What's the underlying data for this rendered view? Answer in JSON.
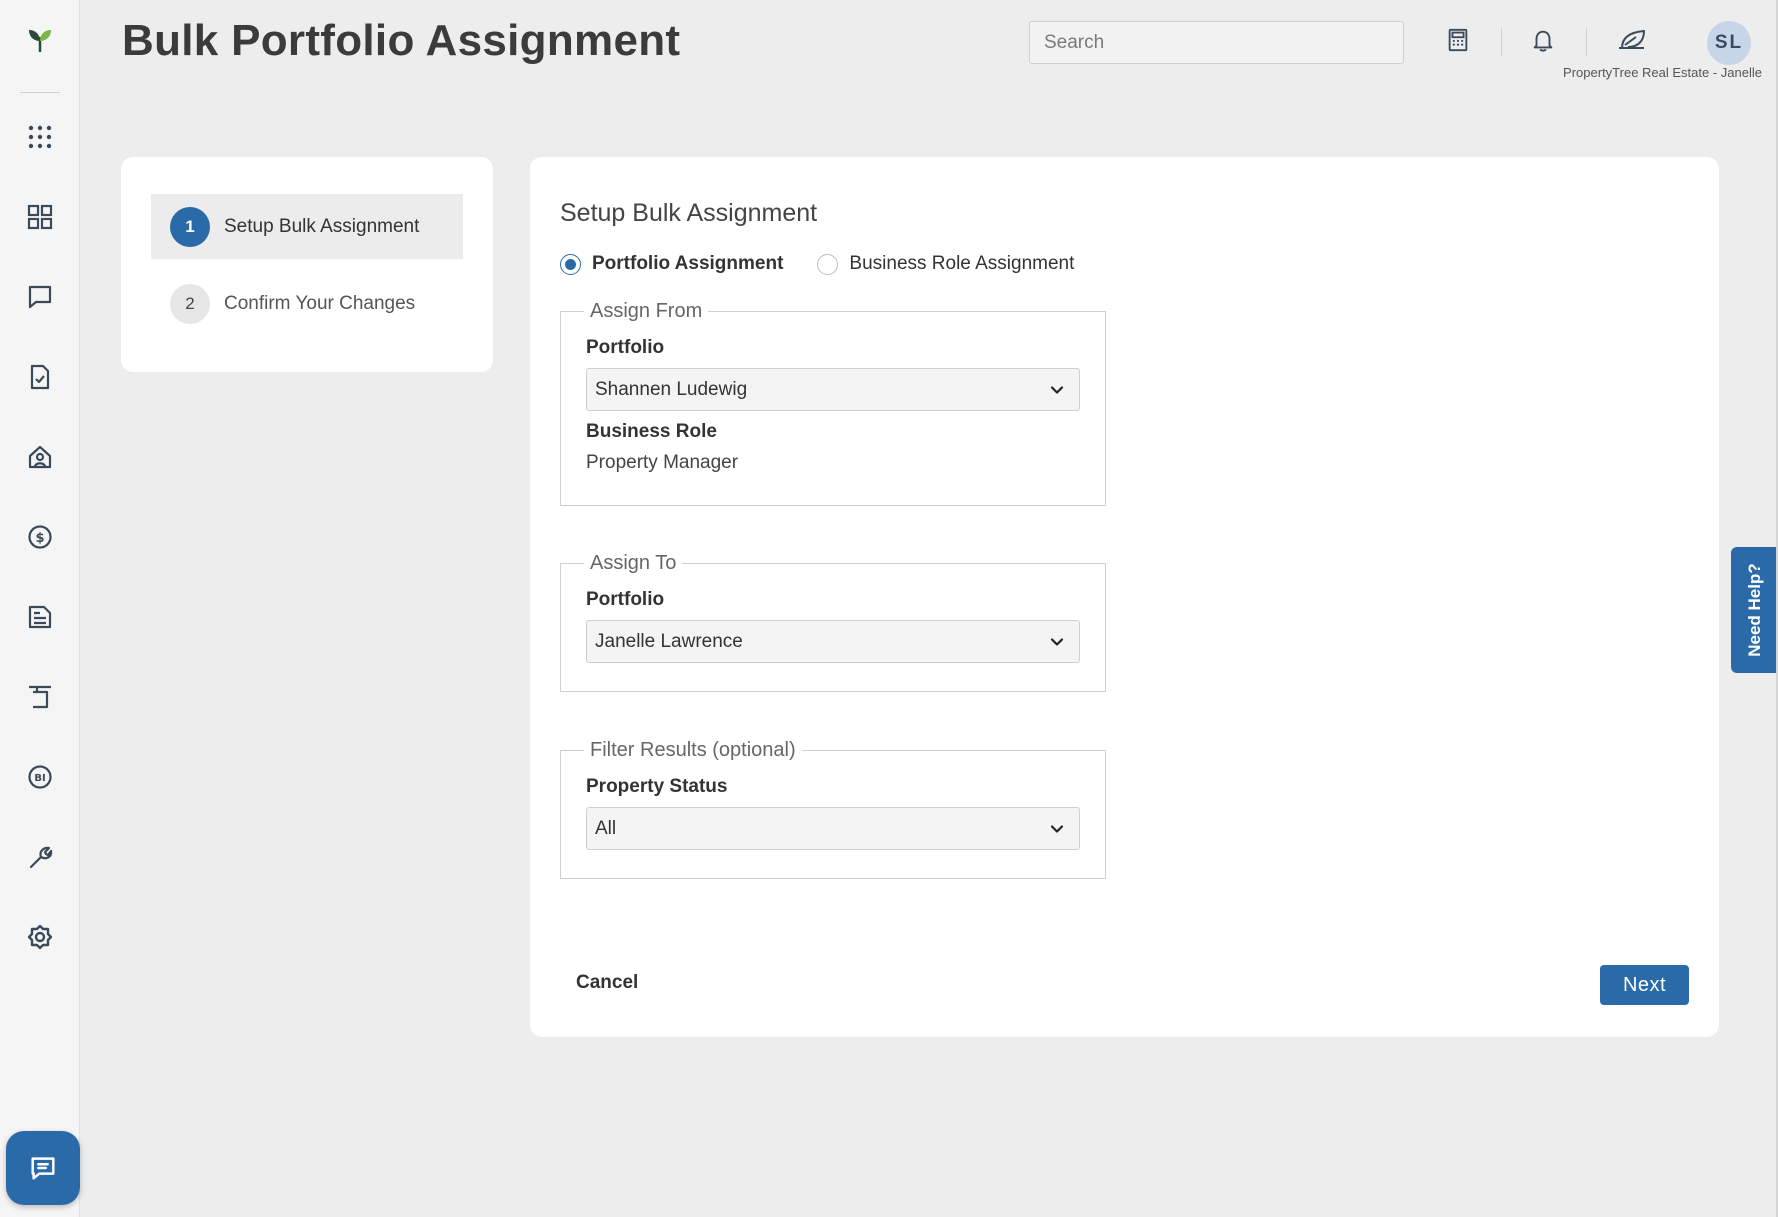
{
  "header": {
    "title": "Bulk Portfolio Assignment",
    "search_placeholder": "Search",
    "avatar_initials": "SL",
    "org_label": "PropertyTree Real Estate - Janelle"
  },
  "sidebar": {
    "items": [
      "apps-grid-icon",
      "dashboard-icon",
      "messages-icon",
      "tasks-icon",
      "properties-icon",
      "finance-icon",
      "documents-icon",
      "inspections-icon",
      "bi-icon",
      "maintenance-icon",
      "settings-icon"
    ]
  },
  "steps": [
    {
      "number": "1",
      "label": "Setup Bulk Assignment",
      "active": true
    },
    {
      "number": "2",
      "label": "Confirm Your Changes",
      "active": false
    }
  ],
  "main": {
    "title": "Setup Bulk Assignment",
    "radio_options": [
      {
        "label": "Portfolio Assignment",
        "checked": true
      },
      {
        "label": "Business Role Assignment",
        "checked": false
      }
    ],
    "assign_from": {
      "legend": "Assign From",
      "portfolio_label": "Portfolio",
      "portfolio_value": "Shannen Ludewig",
      "role_label": "Business Role",
      "role_value": "Property Manager"
    },
    "assign_to": {
      "legend": "Assign To",
      "portfolio_label": "Portfolio",
      "portfolio_value": "Janelle Lawrence"
    },
    "filter": {
      "legend": "Filter Results (optional)",
      "status_label": "Property Status",
      "status_value": "All"
    },
    "cancel_label": "Cancel",
    "next_label": "Next"
  },
  "help_tab": "Need Help?",
  "colors": {
    "accent": "#2a6aa8",
    "background": "#ededed",
    "card": "#ffffff"
  }
}
